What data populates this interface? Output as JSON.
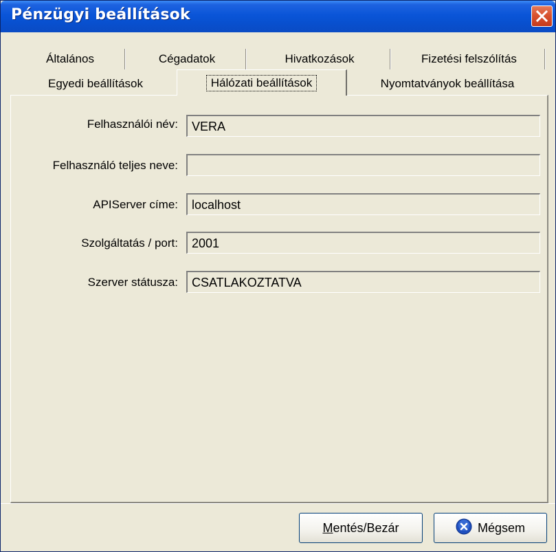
{
  "window": {
    "title": "Pénzügyi beállítások"
  },
  "tabs": {
    "row1": [
      "Általános",
      "Cégadatok",
      "Hivatkozások",
      "Fizetési felszólítás"
    ],
    "row2": [
      "Egyedi beállítások",
      "Hálózati beállítások",
      "Nyomtatványok beállítása"
    ],
    "active": "Hálózati beállítások"
  },
  "form": {
    "fields": [
      {
        "label": "Felhasználói név:",
        "value": "VERA"
      },
      {
        "label": "Felhasználó teljes neve:",
        "value": ""
      },
      {
        "label": "APIServer címe:",
        "value": "localhost"
      },
      {
        "label": "Szolgáltatás / port:",
        "value": "2001"
      },
      {
        "label": "Szerver státusza:",
        "value": "CSATLAKOZTATVA"
      }
    ]
  },
  "buttons": {
    "save_label": "Mentés/Bezár",
    "cancel_label": "Mégsem"
  },
  "colors": {
    "titlebar": "#0a55d8",
    "window_bg": "#ece9d8",
    "close_button": "#d9532f",
    "cancel_icon": "#1f4fbf"
  },
  "icons": {
    "close": "close-icon",
    "cancel": "cancel-x-icon"
  }
}
